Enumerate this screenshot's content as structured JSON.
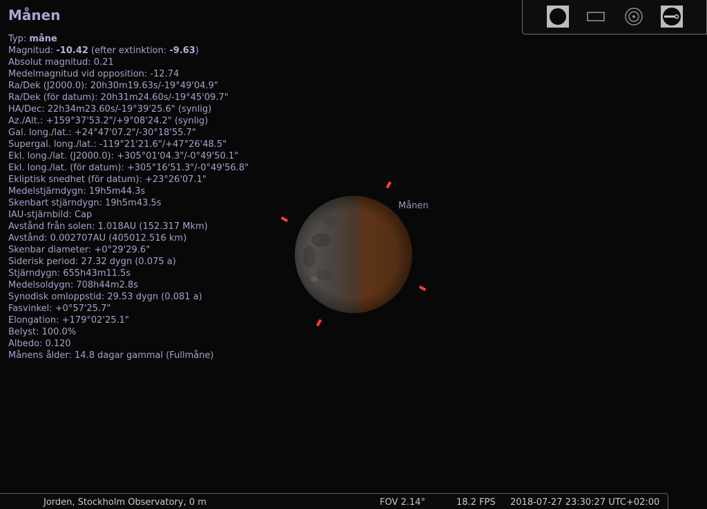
{
  "object": {
    "name": "Månen",
    "sky_label": "Månen"
  },
  "info": {
    "typ_label": "Typ: ",
    "typ_value": "måne",
    "magnitud_label": "Magnitud: ",
    "magnitud_value": "-10.42",
    "magnitud_mid": " (efter extinktion: ",
    "magnitud_ext": "-9.63",
    "magnitud_end": ")",
    "lines": [
      "Absolut magnitud: 0.21",
      "Medelmagnitud vid opposition: -12.74",
      "Ra/Dek (J2000.0): 20h30m19.63s/-19°49'04.9\"",
      "Ra/Dek (för datum): 20h31m24.60s/-19°45'09.7\"",
      "HA/Dec: 22h34m23.60s/-19°39'25.6\" (synlig)",
      "Az./Alt.: +159°37'53.2\"/+9°08'24.2\" (synlig)",
      "Gal. long./lat.: +24°47'07.2\"/-30°18'55.7\"",
      "Supergal. long./lat.: -119°21'21.6\"/+47°26'48.5\"",
      "Ekl. long./lat. (J2000.0): +305°01'04.3\"/-0°49'50.1\"",
      "Ekl. long./lat. (för datum): +305°16'51.3\"/-0°49'56.8\"",
      "Ekliptisk snedhet (för datum): +23°26'07.1\"",
      "Medelstjärndygn: 19h5m44.3s",
      "Skenbart stjärndygn: 19h5m43.5s",
      "IAU-stjärnbild: Cap",
      "Avstånd från solen: 1.018AU (152.317 Mkm)",
      "Avstånd: 0.002707AU (405012.516 km)",
      "Skenbar diameter: +0°29'29.6\"",
      "Siderisk period: 27.32 dygn (0.075 a)",
      "Stjärndygn: 655h43m11.5s",
      "Medelsoldygn: 708h44m2.8s",
      "Synodisk omloppstid: 29.53 dygn (0.081 a)",
      "Fasvinkel: +0°57'25.7\"",
      "Elongation: +179°02'25.1\"",
      "Belyst: 100.0%",
      "Albedo: 0.120",
      "Månens ålder: 14.8 dagar gammal (Fullmåne)"
    ]
  },
  "toolbar": {
    "buttons": [
      {
        "icon": "filled-circle-icon",
        "active": true
      },
      {
        "icon": "rectangle-icon",
        "active": false
      },
      {
        "icon": "concentric-circles-icon",
        "active": false
      },
      {
        "icon": "telescope-toggle-icon",
        "active": true
      }
    ]
  },
  "status": {
    "location": "Jorden, Stockholm Observatory, 0 m",
    "fov": "FOV 2.14°",
    "fps": "18.2 FPS",
    "datetime": "2018-07-27 23:30:27 UTC+02:00"
  },
  "colors": {
    "marker": "#ff3b3b",
    "info_text": "#a3a3cf",
    "title": "#a7a7d6"
  }
}
